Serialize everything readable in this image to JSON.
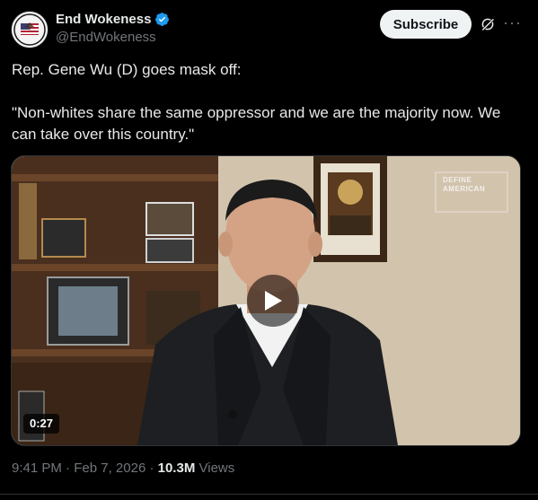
{
  "header": {
    "display_name": "End Wokeness",
    "handle": "@EndWokeness",
    "subscribe_label": "Subscribe",
    "avatar_icon": "flag-eagle-avatar",
    "verified_icon": "verified-badge-icon",
    "grok_icon": "grok-icon",
    "more_icon": "more-icon",
    "verified_color": "#1d9bf0"
  },
  "tweet": {
    "line1": "Rep. Gene Wu (D) goes mask off:",
    "line2": "\"Non-whites share the same oppressor and we are the majority now. We can take over this country.\""
  },
  "media": {
    "duration": "0:27",
    "play_icon": "play-icon",
    "watermark_line1": "DEFINE",
    "watermark_line2": "AMERICAN"
  },
  "meta": {
    "time": "9:41 PM",
    "separator": "·",
    "date": "Feb 7, 2026",
    "views_count": "10.3M",
    "views_label": "Views"
  },
  "colors": {
    "background": "#000000",
    "text": "#e7e9ea",
    "muted": "#71767b",
    "button_bg": "#eff3f4"
  }
}
